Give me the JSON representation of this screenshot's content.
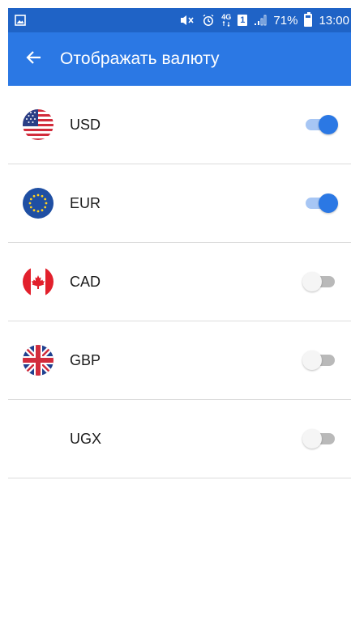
{
  "status_bar": {
    "battery_percent": "71%",
    "time": "13:00",
    "network": "4G",
    "sim": "1",
    "icons": [
      "gallery-icon",
      "mute-icon",
      "alarm-icon",
      "network-4g-icon",
      "sim-1-icon",
      "signal-icon",
      "battery-icon"
    ],
    "battery_level": 0.71
  },
  "app_bar": {
    "title": "Отображать валюту",
    "back_icon": "arrow-left-icon",
    "color": "#2b78e4"
  },
  "currencies": [
    {
      "code": "USD",
      "flag": "us-flag-icon",
      "enabled": true
    },
    {
      "code": "EUR",
      "flag": "eu-flag-icon",
      "enabled": true
    },
    {
      "code": "CAD",
      "flag": "canada-flag-icon",
      "enabled": false
    },
    {
      "code": "GBP",
      "flag": "uk-flag-icon",
      "enabled": false
    },
    {
      "code": "UGX",
      "flag": "",
      "enabled": false
    }
  ],
  "colors": {
    "accent": "#2b78e4",
    "status_bar": "#1f63c6",
    "toggle_on_track": "#a7c6f4",
    "toggle_off_track": "#b9b9b9",
    "divider": "#dcdcdc"
  }
}
